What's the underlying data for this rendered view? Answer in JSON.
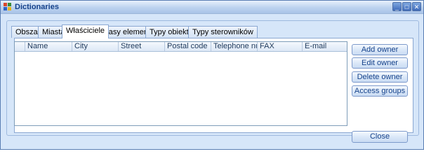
{
  "window": {
    "title": "Dictionaries"
  },
  "tabs": [
    {
      "label": "Obszary",
      "active": false
    },
    {
      "label": "Miasta",
      "active": false
    },
    {
      "label": "Właściciele",
      "active": true
    },
    {
      "label": "Klasy elementów",
      "active": false
    },
    {
      "label": "Typy obiektów",
      "active": false
    },
    {
      "label": "Typy sterowników",
      "active": false
    }
  ],
  "grid": {
    "columns": [
      "Name",
      "City",
      "Street",
      "Postal code",
      "Telephone nu...",
      "FAX",
      "E-mail"
    ]
  },
  "actions": {
    "add_owner": "Add owner",
    "edit_owner": "Edit owner",
    "delete_owner": "Delete owner",
    "access_groups": "Access groups",
    "close": "Close"
  },
  "colors": {
    "title_text": "#15428b",
    "frame": "#c2d9f5"
  }
}
